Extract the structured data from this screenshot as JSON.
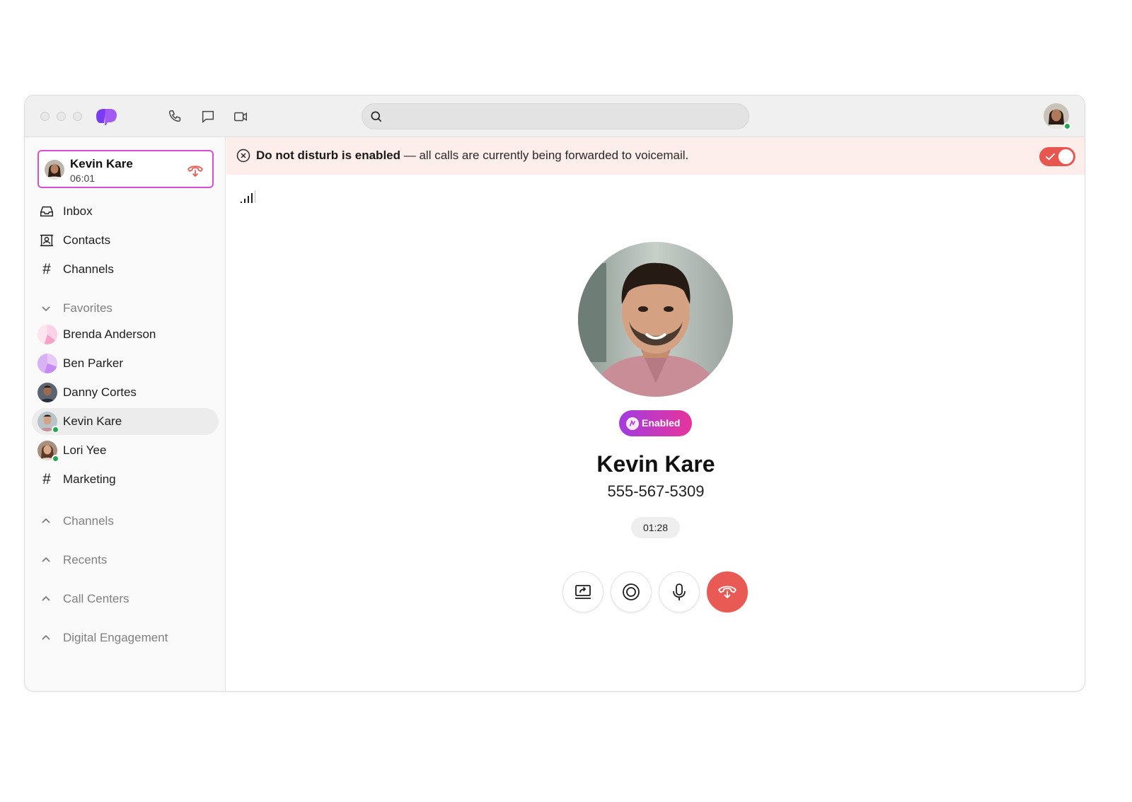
{
  "app": {
    "icons": [
      "dialpad-logo-icon",
      "phone-icon",
      "chat-icon",
      "video-icon",
      "search-icon"
    ],
    "search": {
      "value": "",
      "placeholder": ""
    },
    "accent_color": "#d84fd4",
    "danger_color": "#ea5a55"
  },
  "sidebar": {
    "active_call": {
      "name": "Kevin Kare",
      "time": "06:01"
    },
    "nav": [
      {
        "label": "Inbox",
        "icon": "inbox-icon"
      },
      {
        "label": "Contacts",
        "icon": "contacts-icon"
      },
      {
        "label": "Channels",
        "icon": "hash-icon"
      }
    ],
    "favorites": {
      "title": "Favorites",
      "items": [
        {
          "label": "Brenda Anderson",
          "avatar": "gradient-pink",
          "online": false
        },
        {
          "label": "Ben Parker",
          "avatar": "gradient-purple",
          "online": false
        },
        {
          "label": "Danny Cortes",
          "avatar": "photo",
          "online": false
        },
        {
          "label": "Kevin Kare",
          "avatar": "photo",
          "online": true,
          "selected": true
        },
        {
          "label": "Lori Yee",
          "avatar": "photo",
          "online": true
        },
        {
          "label": "Marketing",
          "avatar": "hash-icon",
          "online": false
        }
      ]
    },
    "sections": [
      {
        "label": "Channels"
      },
      {
        "label": "Recents"
      },
      {
        "label": "Call Centers"
      },
      {
        "label": "Digital Engagement"
      }
    ]
  },
  "banner": {
    "bold": "Do not disturb is enabled",
    "rest": " — all calls are currently being forwarded to voicemail.",
    "toggle_on": true,
    "background": "#fdeeec"
  },
  "call": {
    "badge": "Enabled",
    "name": "Kevin Kare",
    "number": "555-567-5309",
    "duration": "01:28",
    "controls": [
      "screen-share-icon",
      "record-icon",
      "microphone-icon",
      "hang-up-icon"
    ]
  }
}
